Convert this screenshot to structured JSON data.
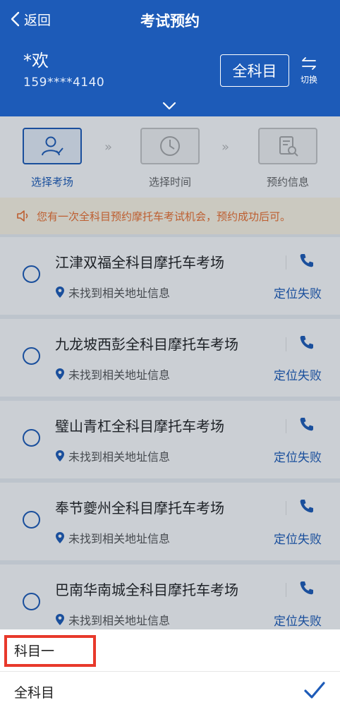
{
  "header": {
    "back_label": "返回",
    "title": "考试预约",
    "user_name": "*欢",
    "user_phone": "159****4140",
    "subject_button": "全科目",
    "switch_label": "切换"
  },
  "steps": [
    {
      "label": "选择考场",
      "active": true
    },
    {
      "label": "选择时间",
      "active": false
    },
    {
      "label": "预约信息",
      "active": false
    }
  ],
  "notice": "您有一次全科目预约摩托车考试机会，预约成功后可。",
  "venues": [
    {
      "name": "江津双福全科目摩托车考场",
      "address": "未找到相关地址信息",
      "status": "定位失败"
    },
    {
      "name": "九龙坡西彭全科目摩托车考场",
      "address": "未找到相关地址信息",
      "status": "定位失败"
    },
    {
      "name": "璧山青杠全科目摩托车考场",
      "address": "未找到相关地址信息",
      "status": "定位失败"
    },
    {
      "name": "奉节夔州全科目摩托车考场",
      "address": "未找到相关地址信息",
      "status": "定位失败"
    },
    {
      "name": "巴南华南城全科目摩托车考场",
      "address": "未找到相关地址信息",
      "status": "定位失败"
    }
  ],
  "sheet": {
    "options": [
      {
        "label": "科目一",
        "selected": false
      },
      {
        "label": "全科目",
        "selected": true
      }
    ]
  },
  "colors": {
    "primary": "#1d5bb8",
    "notice_text": "#ee6f2d",
    "notice_bg": "#fff8e6",
    "highlight": "#e8392b"
  }
}
